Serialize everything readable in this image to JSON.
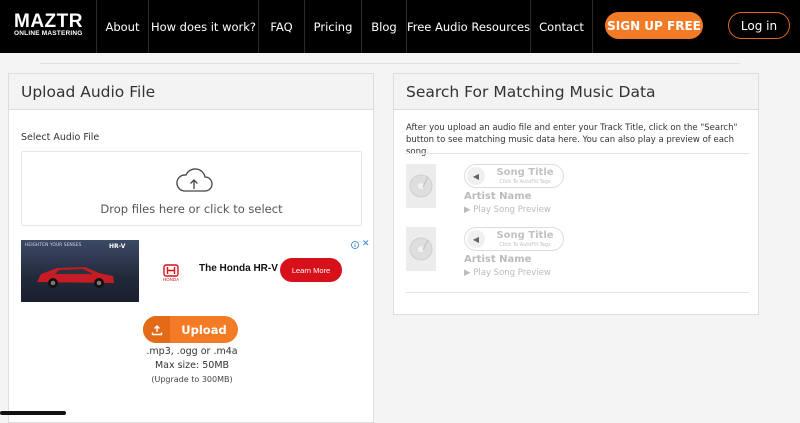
{
  "brand": {
    "name": "MAZTR",
    "tagline": "ONLINE MASTERING"
  },
  "nav": {
    "items": [
      {
        "label": "About"
      },
      {
        "label": "How does it work?"
      },
      {
        "label": "FAQ"
      },
      {
        "label": "Pricing"
      },
      {
        "label": "Blog"
      },
      {
        "label": "Free Audio Resources"
      },
      {
        "label": "Contact"
      }
    ],
    "signup_label": "SIGN UP FREE",
    "login_label": "Log in"
  },
  "upload_panel": {
    "title": "Upload Audio File",
    "select_label": "Select Audio File",
    "dropzone_text": "Drop files here or click to select",
    "upload_label": "Upload",
    "file_types": ".mp3, .ogg or .m4a",
    "max_size": "Max size: 50MB",
    "upgrade_note": "(Upgrade to 300MB)"
  },
  "ad": {
    "tagline": "HEIGHTEN YOUR SENSES",
    "model_badge": "HR-V",
    "brand_name": "HONDA",
    "headline": "The Honda HR-V",
    "cta_label": "Learn More"
  },
  "search_panel": {
    "title": "Search For Matching Music Data",
    "instructions": "After you upload an audio file and enter your Track Title, click on the \"Search\" button to see matching music data here. You can also play a preview of each song.",
    "songs": [
      {
        "title": "Song Title",
        "subtitle": "Click To AutoFill Tags",
        "artist": "Artist Name",
        "preview": "Play Song Preview"
      },
      {
        "title": "Song Title",
        "subtitle": "Click To AutoFill Tags",
        "artist": "Artist Name",
        "preview": "Play Song Preview"
      }
    ]
  },
  "colors": {
    "accent": "#f47b26",
    "nav_bg": "#000000",
    "ad_cta": "#d7101a"
  }
}
